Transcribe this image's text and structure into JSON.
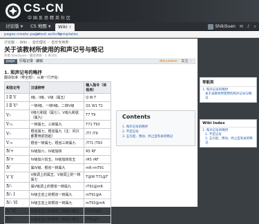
{
  "header": {
    "logo_text": "CS-CN",
    "logo_subtitle": "中国反恐精英社区",
    "colors": {
      "banner": "#1c1f22",
      "nav": "#2c3035",
      "link": "#2a5db0",
      "accent": "#e07b00"
    }
  },
  "nav": {
    "tabs": [
      {
        "label": "讨论版",
        "icon": "chevron-down-icon"
      },
      {
        "label": "CS 地图",
        "icon": "chevron-down-icon"
      },
      {
        "label": "Wiki",
        "icon": "chevron-down-icon"
      }
    ],
    "username": "ShikiSuen"
  },
  "wikibar": {
    "links": [
      "pages",
      "create page",
      "latest activity",
      "templates"
    ]
  },
  "page": {
    "breadcrumb": [
      "讨论版",
      "Wiki",
      "音乐理论",
      "音乐专用表"
    ],
    "title": "关于该教材所使用的和声记号与略记",
    "meta": "作者 ShikiSuen ⋅ 最近更新 ⋅ 1 条讨论",
    "bar": {
      "items": [
        "page",
        "历程记录",
        "编辑"
      ],
      "right": [
        "discussion",
        "关注",
        "⋯"
      ]
    }
  },
  "section": {
    "title": "1. 和声记号的略抒",
    "note": "翻译标准（带全部）：从第一行开始：",
    "table": {
      "headers": [
        "和弦记号",
        "汉语称呼",
        "输入指令（目视用）"
      ],
      "rows": [
        {
          "symbol": "Ⅰ Ⅱ Ⅴ",
          "name": "I级、II级、V级（属五）",
          "input": "Q W T"
        },
        {
          "symbol": "Ⅰ Ⅱ Ⅴ¹",
          "name": "一转I级、一转II级、二转V级",
          "input": "Q1 W1 T1"
        },
        {
          "symbol": "Ⅴ₇",
          "name": "V级七和弦（属七），V级九和弦（属九）",
          "input": "T7 T9"
        },
        {
          "symbol": "Ⅴ₇₃",
          "name": "一转属七、三转属九",
          "input": "T71 T93"
        },
        {
          "symbol": "Ⅴ₇",
          "name": "根省属七、根省属九（注：问只都要用前括起）",
          "input": "/T7 /T9"
        },
        {
          "symbol": "Ⅴ₇₉",
          "name": "根省一转属七、根省三转属九",
          "input": "/T71 /T93"
        },
        {
          "symbol": "Ⅳ+",
          "name": "IV级加六、IV级加四",
          "input": "R5 RF"
        },
        {
          "symbol": "Ⅳ+",
          "name": "IV级加六省五、IV级加四省五",
          "input": "rR5 rRF"
        },
        {
          "symbol": "Ⅳ",
          "name": "属IV级、根省一转属九",
          "input": "mR rmT91"
        },
        {
          "symbol": "Ⅴ Ⅴ",
          "name": "V级调上的属五、V级调上的一转属七",
          "input": "T@W T71@T"
        },
        {
          "symbol": "Ⅳ₇",
          "name": "属V级调上的根省一转属九",
          "input": "rT91@mR"
        },
        {
          "symbol": "Ⅳ₇ Ⅰ",
          "name": "IV级主音上的根省一转属九",
          "input": "mT91@A"
        },
        {
          "symbol": "Ⅳ₇ Ⅵ",
          "name": "IV级主音上的根省一转属九",
          "input": "mT93@mR"
        },
        {
          "symbol": "Ⅳ Ⅵ",
          "name": "IV级主音上的根省二转属九两五",
          "input": "rT921@T"
        },
        {
          "symbol": "Ⅳ₇₊",
          "name": "IV级主音上的根省一转属九两五",
          "input": "rT91@T"
        }
      ]
    }
  },
  "toc": {
    "title": "Contents",
    "items": [
      "1. 和声记号的略抒",
      "2. 不定记号",
      "3. 五引起、预动、终止型有关的略记"
    ]
  },
  "sidebar": {
    "nav_title": "导航到",
    "nav_items": [
      "1. 和声记号的略抒",
      "关于该教材所使用的和声记号与略记",
      "1. 和声记号的略抒",
      "2. 不定记号",
      "3. 五引起、预动、终止型有关的略记"
    ],
    "wiki_index_title": "Wiki Index"
  }
}
